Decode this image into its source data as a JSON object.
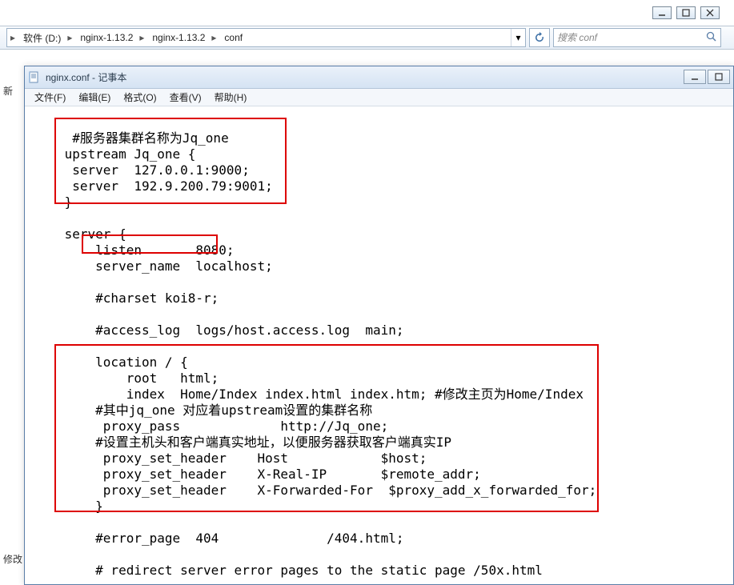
{
  "window_controls": {
    "minimize": "minimize",
    "maximize": "maximize",
    "close": "close"
  },
  "breadcrumb": {
    "items": [
      "软件 (D:)",
      "nginx-1.13.2",
      "nginx-1.13.2",
      "conf"
    ]
  },
  "search": {
    "placeholder": "搜索 conf"
  },
  "sidebar": {
    "item1": "新",
    "item2": "修改"
  },
  "notepad": {
    "title": "nginx.conf - 记事本",
    "menu": [
      "文件(F)",
      "编辑(E)",
      "格式(O)",
      "查看(V)",
      "帮助(H)"
    ]
  },
  "code": "\n  #服务器集群名称为Jq_one\n upstream Jq_one {\n  server  127.0.0.1:9000;\n  server  192.9.200.79:9001;\n }\n\n server {\n     listen       8080;\n     server_name  localhost;\n\n     #charset koi8-r;\n\n     #access_log  logs/host.access.log  main;\n\n     location / {\n         root   html;\n         index  Home/Index index.html index.htm; #修改主页为Home/Index\n     #其中jq_one 对应着upstream设置的集群名称\n      proxy_pass             http://Jq_one;\n     #设置主机头和客户端真实地址，以便服务器获取客户端真实IP\n      proxy_set_header    Host            $host;\n      proxy_set_header    X-Real-IP       $remote_addr;\n      proxy_set_header    X-Forwarded-For  $proxy_add_x_forwarded_for;\n     }\n\n     #error_page  404              /404.html;\n\n     # redirect server error pages to the static page /50x.html"
}
